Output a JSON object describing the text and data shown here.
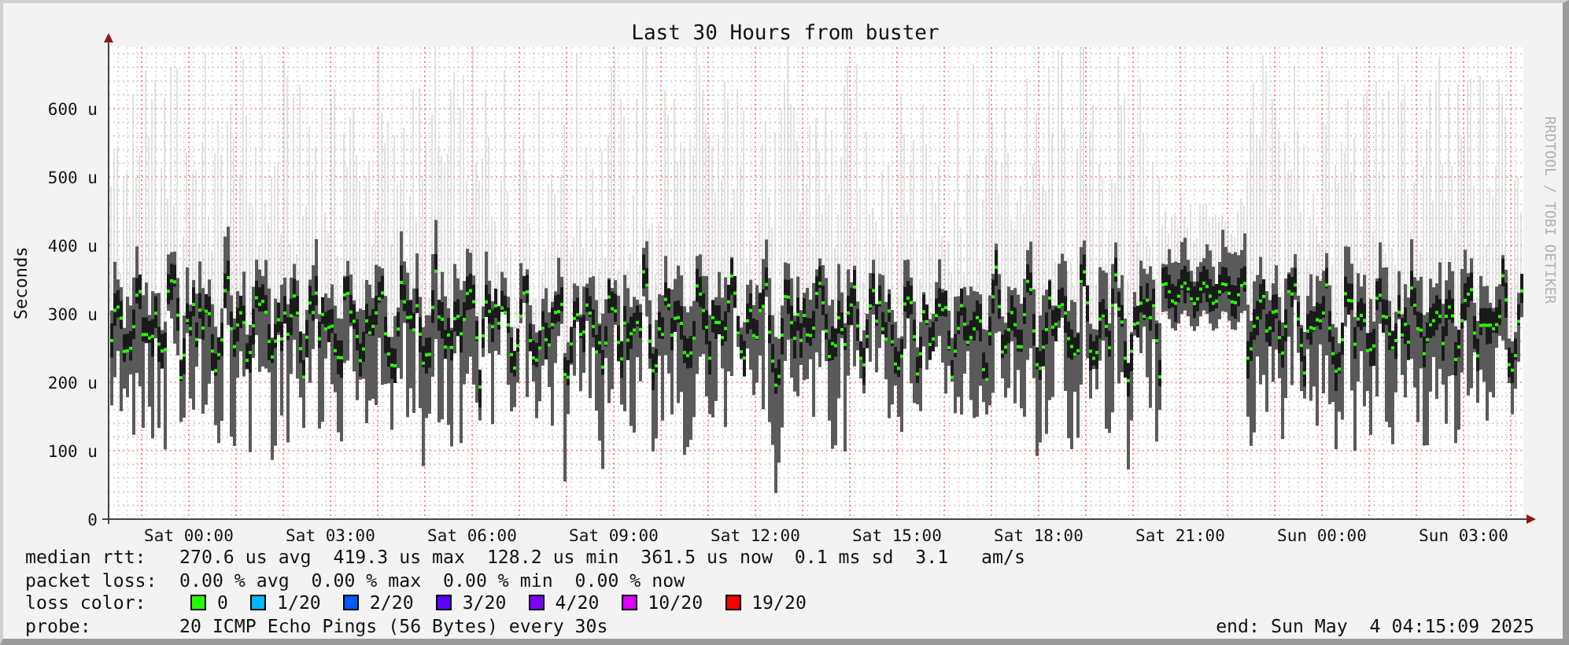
{
  "graph": {
    "title": "Last 30 Hours from buster",
    "credit": "RRDTOOL / TOBI OETIKER",
    "y_axis": {
      "label": "Seconds",
      "ticks": [
        "600 u",
        "500 u",
        "400 u",
        "300 u",
        "200 u",
        "100 u",
        "0"
      ]
    },
    "x_axis": {
      "ticks": [
        "Sat 00:00",
        "Sat 03:00",
        "Sat 06:00",
        "Sat 09:00",
        "Sat 12:00",
        "Sat 15:00",
        "Sat 18:00",
        "Sat 21:00",
        "Sun 00:00",
        "Sun 03:00"
      ]
    }
  },
  "legend": {
    "median_rtt": {
      "label": "median rtt:",
      "text": "270.6 us avg  419.3 us max  128.2 us min  361.5 us now  0.1 ms sd  3.1   am/s"
    },
    "packet_loss": {
      "label": "packet loss:",
      "text": "0.00 % avg  0.00 % max  0.00 % min  0.00 % now"
    },
    "loss_color": {
      "label": "loss color:",
      "items": [
        {
          "label": "0",
          "color": "#26ff00"
        },
        {
          "label": "1/20",
          "color": "#00b8ff"
        },
        {
          "label": "2/20",
          "color": "#0059ff"
        },
        {
          "label": "3/20",
          "color": "#5e00ff"
        },
        {
          "label": "4/20",
          "color": "#7e00ff"
        },
        {
          "label": "10/20",
          "color": "#dd00ff"
        },
        {
          "label": "19/20",
          "color": "#ff0000"
        }
      ]
    },
    "probe": {
      "label": "probe:",
      "text": "20 ICMP Echo Pings (56 Bytes) every 30s"
    },
    "end": "end: Sun May  4 04:15:09 2025"
  }
}
